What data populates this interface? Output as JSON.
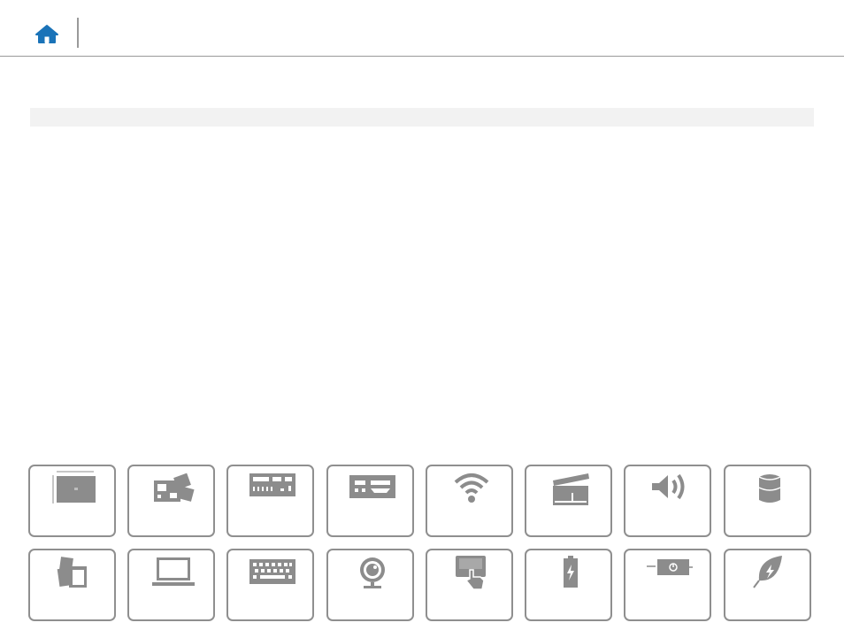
{
  "header": {
    "home_icon": "home-icon",
    "title": ""
  },
  "section": {
    "heading": ""
  },
  "colors": {
    "accent": "#1a73b8",
    "icon_gray": "#8c8c8c",
    "border_gray": "#8f8f8f",
    "bar_gray": "#f2f2f2"
  },
  "tiles": [
    {
      "name": "dimensions-weight",
      "icon": "laptop-dimensions-icon",
      "label": ""
    },
    {
      "name": "system-information",
      "icon": "motherboard-icon",
      "label": ""
    },
    {
      "name": "ports-connectors",
      "icon": "ports-connectors-icon",
      "label": ""
    },
    {
      "name": "media-card-reader",
      "icon": "card-reader-slot-icon",
      "label": ""
    },
    {
      "name": "communications",
      "icon": "wifi-icon",
      "label": ""
    },
    {
      "name": "video",
      "icon": "clapperboard-icon",
      "label": ""
    },
    {
      "name": "audio",
      "icon": "speaker-icon",
      "label": ""
    },
    {
      "name": "storage",
      "icon": "storage-cylinder-icon",
      "label": ""
    },
    {
      "name": "memory-cards",
      "icon": "memory-cards-icon",
      "label": ""
    },
    {
      "name": "display",
      "icon": "laptop-display-icon",
      "label": ""
    },
    {
      "name": "keyboard",
      "icon": "keyboard-icon",
      "label": ""
    },
    {
      "name": "camera",
      "icon": "webcam-icon",
      "label": ""
    },
    {
      "name": "touchpad",
      "icon": "touchpad-icon",
      "label": ""
    },
    {
      "name": "battery",
      "icon": "battery-icon",
      "label": ""
    },
    {
      "name": "power-adapter",
      "icon": "power-adapter-icon",
      "label": ""
    },
    {
      "name": "environmental",
      "icon": "leaf-icon",
      "label": ""
    }
  ]
}
